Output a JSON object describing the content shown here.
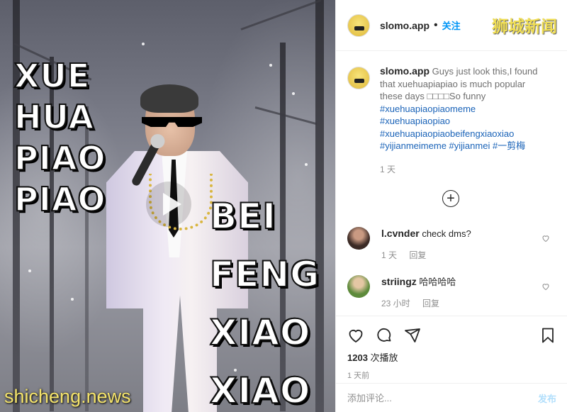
{
  "media": {
    "overlay_left": [
      "XUE",
      "HUA",
      "PIAO",
      "PIAO"
    ],
    "overlay_right": [
      "BEI",
      "FENG",
      "XIAO",
      "XIAO"
    ],
    "watermark": "shicheng.news"
  },
  "header": {
    "username": "slomo.app",
    "separator": "•",
    "follow_label": "关注",
    "brand_tag": "狮城新闻"
  },
  "caption": {
    "username": "slomo.app",
    "text": " Guys just look this,I found that xuehuapiapiao is much popular these days □□□□So funny",
    "hashtag_lines": [
      "#xuehuapiaopiaomeme",
      "#xuehuapiaopiao",
      "#xuehuapiaopiaobeifengxiaoxiao",
      "#yijianmeimeme #yijianmei #一剪梅"
    ],
    "time": "1 天"
  },
  "comments": [
    {
      "username": "l.cvnder",
      "text": "check dms?",
      "time": "1 天",
      "reply": "回复"
    },
    {
      "username": "striingz",
      "text": "哈哈哈哈",
      "time": "23 小时",
      "reply": "回复"
    }
  ],
  "actions": {
    "views_count": "1203",
    "views_label": " 次播放",
    "post_time": "1 天前"
  },
  "add_comment": {
    "placeholder": "添加评论...",
    "publish_label": "发布"
  },
  "colors": {
    "accent": "#0095f6",
    "hashtag": "#1a63b8",
    "publish_disabled": "#b2dffc",
    "watermark": "#f4e36b"
  }
}
